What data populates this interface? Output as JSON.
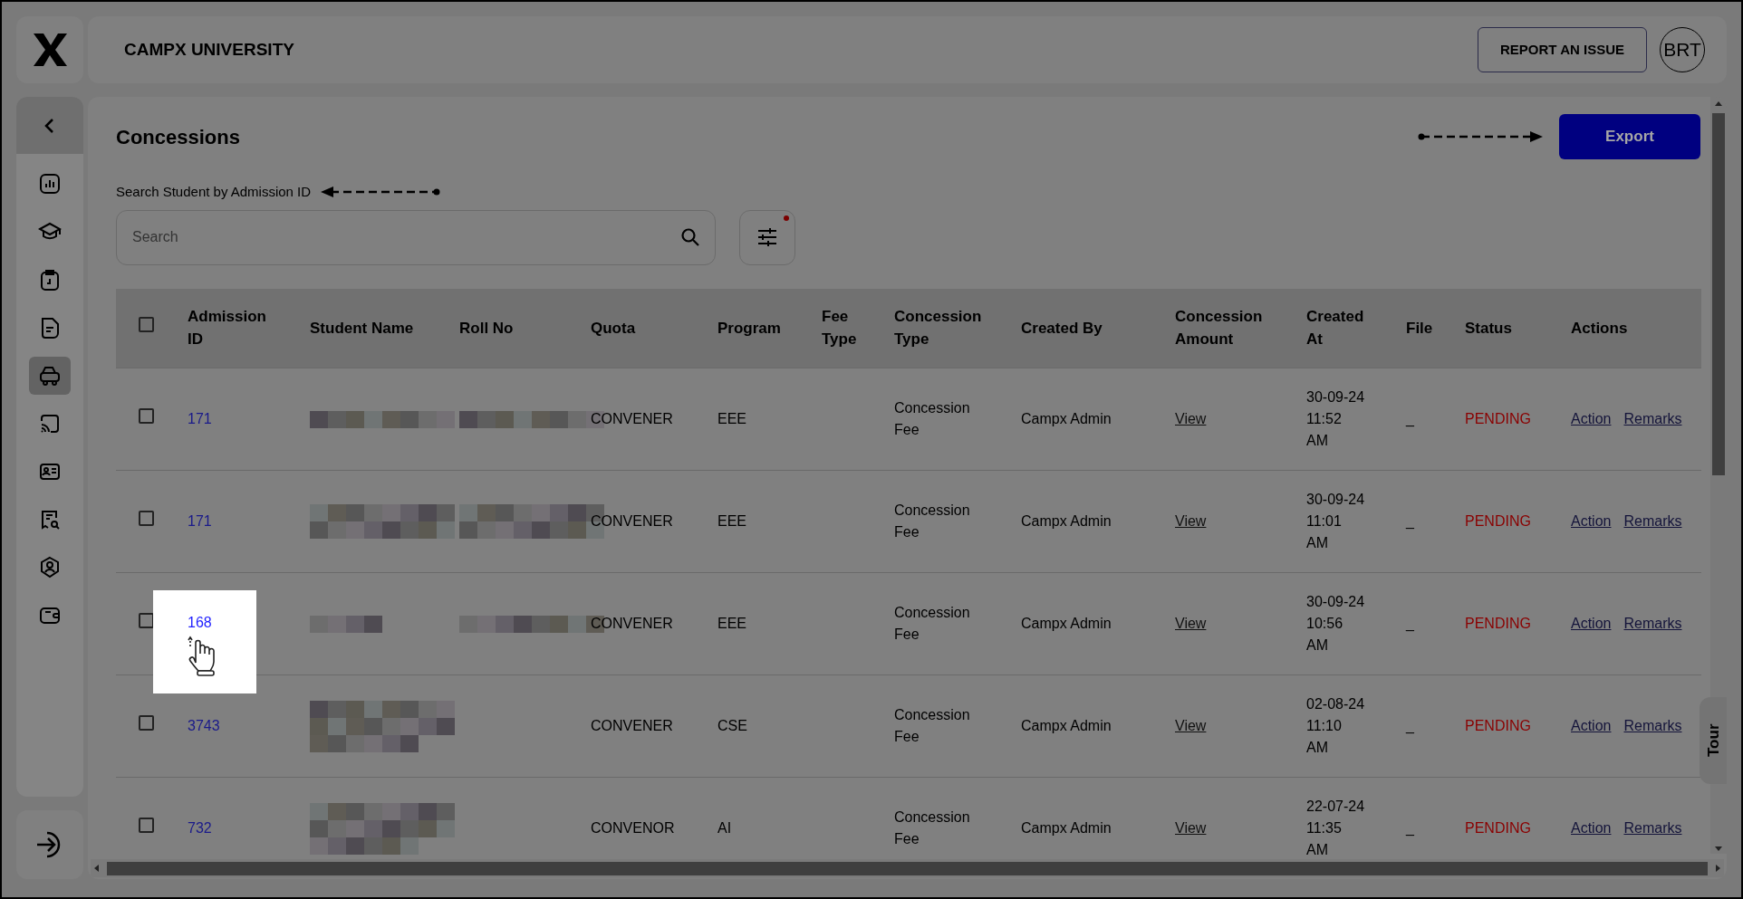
{
  "header": {
    "title": "CAMPX UNIVERSITY",
    "report_button": "REPORT AN ISSUE",
    "avatar": "BRT"
  },
  "sidebar": {
    "items": [
      {
        "selected": false
      },
      {
        "selected": false
      },
      {
        "selected": false
      },
      {
        "selected": false
      },
      {
        "selected": true
      },
      {
        "selected": false
      },
      {
        "selected": false
      },
      {
        "selected": false
      },
      {
        "selected": false
      },
      {
        "selected": false
      }
    ]
  },
  "page": {
    "title": "Concessions",
    "search_label": "Search Student by Admission ID",
    "search": {
      "placeholder": "Search"
    },
    "filter_active": true,
    "export_button": "Export"
  },
  "table": {
    "select_all_checked": false,
    "columns": [
      "Admission ID",
      "Student Name",
      "Roll No",
      "Quota",
      "Program",
      "Fee Type",
      "Concession Type",
      "Created By",
      "Concession Amount",
      "Created At",
      "File",
      "Status",
      "Actions"
    ],
    "rows": [
      {
        "checked": false,
        "spotlight": false,
        "admission_id": "171",
        "student_name": {
          "kind": "redacted"
        },
        "roll_no": {
          "kind": "redacted"
        },
        "quota": "CONVENER",
        "program": "EEE",
        "concession_type": "Concession Fee",
        "created_by": "Campx Admin",
        "concession_amount": "View",
        "created_at": "30-09-24 11:52 AM",
        "file": "_",
        "status": "PENDING",
        "actions": [
          "Action",
          "Remarks"
        ]
      },
      {
        "checked": false,
        "spotlight": false,
        "admission_id": "171",
        "student_name": {
          "kind": "redacted"
        },
        "roll_no": {
          "kind": "redacted"
        },
        "quota": "CONVENER",
        "program": "EEE",
        "concession_type": "Concession Fee",
        "created_by": "Campx Admin",
        "concession_amount": "View",
        "created_at": "30-09-24 11:01 AM",
        "file": "_",
        "status": "PENDING",
        "actions": [
          "Action",
          "Remarks"
        ]
      },
      {
        "checked": false,
        "spotlight": true,
        "admission_id": "168",
        "student_name": {
          "kind": "redacted"
        },
        "roll_no": {
          "kind": "redacted"
        },
        "quota": "CONVENER",
        "program": "EEE",
        "concession_type": "Concession Fee",
        "created_by": "Campx Admin",
        "concession_amount": "View",
        "created_at": "30-09-24 10:56 AM",
        "file": "_",
        "status": "PENDING",
        "actions": [
          "Action",
          "Remarks"
        ]
      },
      {
        "checked": false,
        "spotlight": false,
        "admission_id": "3743",
        "student_name": {
          "kind": "redacted"
        },
        "quota": "CONVENER",
        "program": "CSE",
        "concession_type": "Concession Fee",
        "created_by": "Campx Admin",
        "concession_amount": "View",
        "created_at": "02-08-24 11:10 AM",
        "file": "_",
        "status": "PENDING",
        "actions": [
          "Action",
          "Remarks"
        ]
      },
      {
        "checked": false,
        "spotlight": false,
        "admission_id": "732",
        "student_name": {
          "kind": "redacted"
        },
        "quota": "CONVENOR",
        "program": "AI",
        "concession_type": "Concession Fee",
        "created_by": "Campx Admin",
        "concession_amount": "View",
        "created_at": "22-07-24 11:35 AM",
        "file": "_",
        "status": "PENDING",
        "actions": [
          "Action",
          "Remarks"
        ]
      }
    ]
  },
  "tour_button": "Tour"
}
